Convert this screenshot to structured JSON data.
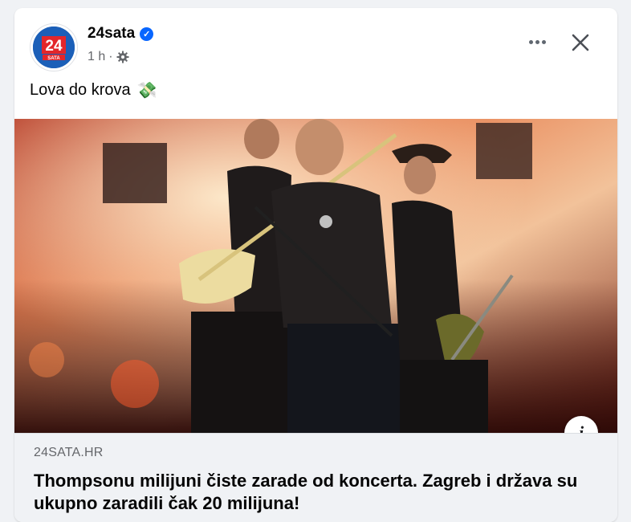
{
  "post": {
    "page_name": "24sata",
    "verified": true,
    "avatar_text": "24",
    "avatar_subtext": "SATA",
    "time": "1 h",
    "meta_separator": "·",
    "privacy_icon": "gear-icon",
    "text": "Lova do krova",
    "emoji": "💸"
  },
  "link": {
    "domain": "24SATA.HR",
    "headline": "Thompsonu milijuni čiste zarade od koncerta. Zagreb i država su ukupno zaradili čak 20 milijuna!"
  },
  "info_label": "i",
  "colors": {
    "brand_red": "#e3262a",
    "brand_blue": "#1b5fb8",
    "verified_blue": "#0866ff"
  }
}
